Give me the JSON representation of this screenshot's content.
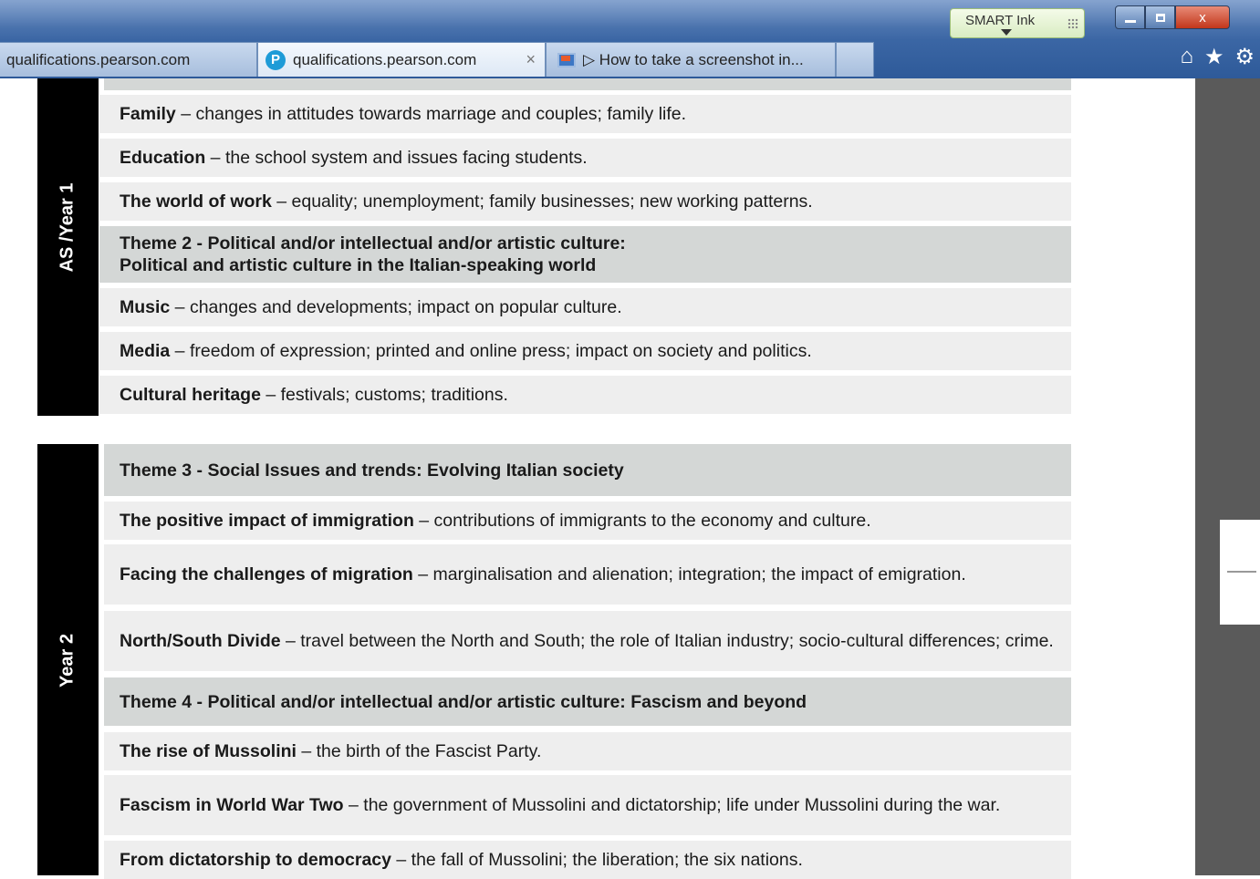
{
  "browser": {
    "smart_ink_label": "SMART Ink",
    "tabs": [
      {
        "label": "qualifications.pearson.com"
      },
      {
        "label": "qualifications.pearson.com",
        "close": "×"
      },
      {
        "label": "▷ How to take a screenshot in..."
      }
    ],
    "window_controls": {
      "close_symbol": "x"
    },
    "nav_icons": [
      "home-icon",
      "favorites-star-icon",
      "settings-gear-icon"
    ]
  },
  "sections": [
    {
      "label": "AS /Year 1",
      "rows": [
        {
          "type": "topic",
          "title": "Family",
          "desc": " – changes in attitudes towards marriage and couples; family life."
        },
        {
          "type": "topic",
          "title": "Education",
          "desc": " – the school system and issues facing students."
        },
        {
          "type": "topic",
          "title": "The world of work",
          "desc": " – equality; unemployment; family businesses; new working patterns."
        },
        {
          "type": "theme",
          "line1": "Theme 2 - Political and/or intellectual and/or artistic culture:",
          "line2": "Political and artistic culture in the Italian-speaking world"
        },
        {
          "type": "topic",
          "title": "Music",
          "desc": " – changes and developments; impact on popular culture."
        },
        {
          "type": "topic",
          "title": "Media",
          "desc": " – freedom of expression; printed and online press; impact on society and politics."
        },
        {
          "type": "topic",
          "title": "Cultural heritage",
          "desc": " – festivals; customs; traditions."
        }
      ]
    },
    {
      "label": "Year 2",
      "rows": [
        {
          "type": "theme",
          "line1": "Theme 3 - Social Issues and trends: Evolving Italian society"
        },
        {
          "type": "topic",
          "title": "The positive impact of immigration",
          "desc": " – contributions of immigrants to the economy and culture."
        },
        {
          "type": "topic",
          "title": "Facing the challenges of migration",
          "desc": " – marginalisation and alienation; integration; the impact of emigration."
        },
        {
          "type": "topic",
          "title": "North/South Divide",
          "desc": " – travel between the North and South; the role of Italian industry; socio-cultural differences; crime."
        },
        {
          "type": "theme",
          "line1": "Theme 4 - Political and/or intellectual and/or artistic culture: Fascism and beyond"
        },
        {
          "type": "topic",
          "title": "The rise of Mussolini",
          "desc": " – the birth of the Fascist Party."
        },
        {
          "type": "topic",
          "title": "Fascism in World War Two",
          "desc": " – the government of Mussolini and dictatorship; life under Mussolini during the war."
        },
        {
          "type": "topic",
          "title": "From dictatorship to democracy",
          "desc": " – the fall of Mussolini; the liberation; the six nations."
        }
      ]
    }
  ]
}
